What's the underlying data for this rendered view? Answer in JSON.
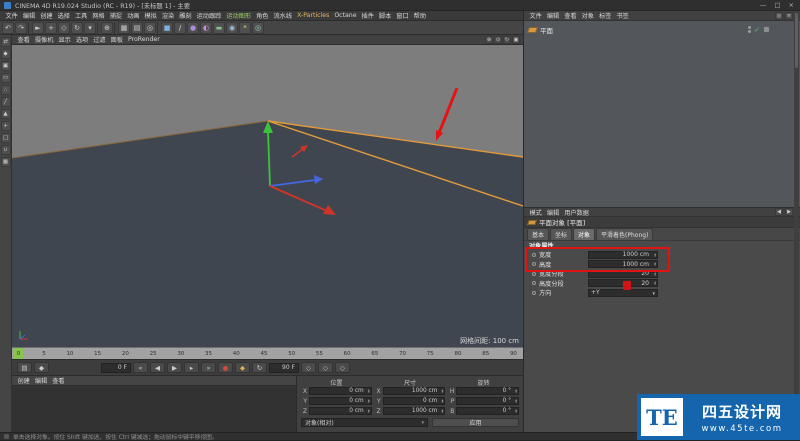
{
  "title_bar": {
    "title": "CINEMA 4D R19.024 Studio (RC - R19) - [未标题 1] - 主要",
    "minimize": "—",
    "maximize": "□",
    "close": "×"
  },
  "menu_bar": {
    "items": [
      {
        "label": "文件"
      },
      {
        "label": "编辑"
      },
      {
        "label": "创建"
      },
      {
        "label": "选择"
      },
      {
        "label": "工具"
      },
      {
        "label": "网格"
      },
      {
        "label": "捕捉"
      },
      {
        "label": "动画"
      },
      {
        "label": "模拟"
      },
      {
        "label": "渲染"
      },
      {
        "label": "雕刻"
      },
      {
        "label": "运动跟踪"
      },
      {
        "label": "运动图形",
        "color": "#9fd06a"
      },
      {
        "label": "角色"
      },
      {
        "label": "流水线"
      },
      {
        "label": "X-Particles",
        "color": "#e8b55a"
      },
      {
        "label": "Octane"
      },
      {
        "label": "插件"
      },
      {
        "label": "脚本"
      },
      {
        "label": "窗口"
      },
      {
        "label": "帮助"
      }
    ]
  },
  "toolbar": {
    "icons": [
      {
        "name": "undo-icon",
        "glyph": "↶"
      },
      {
        "name": "redo-icon",
        "glyph": "↷"
      },
      {
        "name": "separator",
        "glyph": "",
        "sep": true
      },
      {
        "name": "live-selection-icon",
        "glyph": "►"
      },
      {
        "name": "move-tool-icon",
        "glyph": "+"
      },
      {
        "name": "scale-tool-icon",
        "glyph": "◇"
      },
      {
        "name": "rotate-tool-icon",
        "glyph": "↻"
      },
      {
        "name": "last-tool-icon",
        "glyph": "▾"
      },
      {
        "name": "separator",
        "glyph": "",
        "sep": true
      },
      {
        "name": "coordinate-system-icon",
        "glyph": "⊕"
      },
      {
        "name": "separator",
        "glyph": "",
        "sep": true
      },
      {
        "name": "render-view-icon",
        "glyph": "▦"
      },
      {
        "name": "render-picture-viewer-icon",
        "glyph": "▤"
      },
      {
        "name": "render-settings-icon",
        "glyph": "◎"
      },
      {
        "name": "separator",
        "glyph": "",
        "sep": true
      },
      {
        "name": "primitive-cube-icon",
        "glyph": "■",
        "color": "#7fb2e0"
      },
      {
        "name": "spline-pen-icon",
        "glyph": "/",
        "color": "#e0e0e0"
      },
      {
        "name": "subdivision-surface-icon",
        "glyph": "●",
        "color": "#a98fd8"
      },
      {
        "name": "deformer-icon",
        "glyph": "◐",
        "color": "#c98fd8"
      },
      {
        "name": "floor-icon",
        "glyph": "▬",
        "color": "#85c285"
      },
      {
        "name": "camera-icon",
        "glyph": "◉",
        "color": "#9fc3d8"
      },
      {
        "name": "light-icon",
        "glyph": "*",
        "color": "#e8d76a"
      },
      {
        "name": "environment-icon",
        "glyph": "◎",
        "color": "#8fd8c2"
      }
    ]
  },
  "left_palette": {
    "icons": [
      {
        "name": "make-editable-icon",
        "glyph": "⇄"
      },
      {
        "name": "model-mode-icon",
        "glyph": "◆"
      },
      {
        "name": "texture-mode-icon",
        "glyph": "▣"
      },
      {
        "name": "workplane-mode-icon",
        "glyph": "▭"
      },
      {
        "name": "points-mode-icon",
        "glyph": "∴"
      },
      {
        "name": "edges-mode-icon",
        "glyph": "╱"
      },
      {
        "name": "polygons-mode-icon",
        "glyph": "▲"
      },
      {
        "name": "enable-axis-icon",
        "glyph": "+"
      },
      {
        "name": "viewport-solo-icon",
        "glyph": "□"
      },
      {
        "name": "enable-snap-icon",
        "glyph": "∪"
      },
      {
        "name": "workplane-lock-icon",
        "glyph": "▦"
      }
    ]
  },
  "viewport": {
    "menu_items": [
      {
        "label": "查看"
      },
      {
        "label": "摄像机"
      },
      {
        "label": "显示"
      },
      {
        "label": "选项"
      },
      {
        "label": "过滤"
      },
      {
        "label": "面板"
      },
      {
        "label": "ProRender"
      }
    ],
    "corner_icons": [
      {
        "name": "pan-view-icon",
        "glyph": "⊕"
      },
      {
        "name": "zoom-view-icon",
        "glyph": "⊙"
      },
      {
        "name": "rotate-view-icon",
        "glyph": "↻"
      },
      {
        "name": "toggle-view-icon",
        "glyph": "▣"
      }
    ]
  },
  "scene": {
    "background": "#7d7d7d",
    "plane_fill": "#3f4650",
    "edge_orange": "#e39a3b",
    "edge_dim": "#8a6534",
    "axis_green": "#3bc43b",
    "axis_red": "#d03528",
    "axis_blue": "#4466e0",
    "annotation_red": "#e41414",
    "grid_label": "网格间距: 100 cm"
  },
  "timeline": {
    "playhead": "0",
    "ticks": [
      "0",
      "5",
      "10",
      "15",
      "20",
      "25",
      "30",
      "35",
      "40",
      "45",
      "50",
      "55",
      "60",
      "65",
      "70",
      "75",
      "80",
      "85",
      "90"
    ]
  },
  "transport": {
    "start": "0 F",
    "end": "90 F",
    "left_icons": [
      {
        "name": "timeline-mode-icon",
        "glyph": "▤"
      },
      {
        "name": "key-interpolation-icon",
        "glyph": "◆"
      }
    ],
    "buttons": [
      {
        "name": "goto-start-button",
        "glyph": "«"
      },
      {
        "name": "previous-frame-button",
        "glyph": "◀"
      },
      {
        "name": "play-button",
        "glyph": "▶"
      },
      {
        "name": "next-frame-button",
        "glyph": "▸"
      },
      {
        "name": "goto-end-button",
        "glyph": "»"
      },
      {
        "name": "record-keyframe-button",
        "glyph": "●",
        "color": "#d04a3a"
      },
      {
        "name": "autokey-button",
        "glyph": "◆",
        "color": "#d8b24a"
      },
      {
        "name": "loop-button",
        "glyph": "↻"
      }
    ],
    "right_icons": [
      {
        "name": "record-position-icon",
        "glyph": "◇"
      },
      {
        "name": "record-scale-icon",
        "glyph": "◇"
      },
      {
        "name": "record-rotation-icon",
        "glyph": "◇"
      }
    ]
  },
  "materials_panel": {
    "menus": [
      {
        "label": "创建"
      },
      {
        "label": "编辑"
      },
      {
        "label": "查看"
      }
    ]
  },
  "coordinates_panel": {
    "columns": [
      {
        "header": "位置",
        "rows": [
          {
            "label": "X",
            "value": "0 cm"
          },
          {
            "label": "Y",
            "value": "0 cm"
          },
          {
            "label": "Z",
            "value": "0 cm"
          }
        ]
      },
      {
        "header": "尺寸",
        "rows": [
          {
            "label": "X",
            "value": "1000 cm"
          },
          {
            "label": "Y",
            "value": "0 cm"
          },
          {
            "label": "Z",
            "value": "1000 cm"
          }
        ]
      },
      {
        "header": "旋转",
        "rows": [
          {
            "label": "H",
            "value": "0 °"
          },
          {
            "label": "P",
            "value": "0 °"
          },
          {
            "label": "B",
            "value": "0 °"
          }
        ]
      }
    ],
    "mode": "对象(相对)",
    "apply": "应用"
  },
  "object_manager": {
    "menus": [
      {
        "label": "文件"
      },
      {
        "label": "编辑"
      },
      {
        "label": "查看"
      },
      {
        "label": "对象"
      },
      {
        "label": "标签"
      },
      {
        "label": "书签"
      }
    ],
    "corner_icons": [
      {
        "name": "om-search-icon",
        "glyph": "◎"
      },
      {
        "name": "om-filter-icon",
        "glyph": "≡"
      }
    ],
    "object": {
      "name": "平面"
    }
  },
  "attribute_manager": {
    "menus": [
      {
        "label": "模式"
      },
      {
        "label": "编辑"
      },
      {
        "label": "用户数据"
      }
    ],
    "corner_icons": [
      {
        "name": "am-history-back-icon",
        "glyph": "◀"
      },
      {
        "name": "am-history-forward-icon",
        "glyph": "▶"
      }
    ],
    "title": "平面对象 [平面]",
    "tabs": [
      {
        "label": "基本"
      },
      {
        "label": "坐标"
      },
      {
        "label": "对象",
        "active": true
      },
      {
        "label": "平滑着色(Phong)"
      }
    ],
    "section": "对象属性",
    "properties": [
      {
        "label": "宽度",
        "value": "1000 cm",
        "highlight": true
      },
      {
        "label": "高度",
        "value": "1000 cm",
        "highlight": true
      },
      {
        "label": "宽度分段",
        "value": "20"
      },
      {
        "label": "高度分段",
        "value": "20"
      },
      {
        "label": "方向",
        "value": "+Y",
        "dropdown": true
      }
    ],
    "annotation_color": "#e01212"
  },
  "watermark": {
    "logo": "TE",
    "name": "四五设计网",
    "url": "www.45te.com",
    "color": "#1565ad"
  },
  "status_bar": {
    "text": "单击选择对象。按住 Shift 键加选，按住 Ctrl 键减选；拖动鼠标中键平移视图。"
  }
}
